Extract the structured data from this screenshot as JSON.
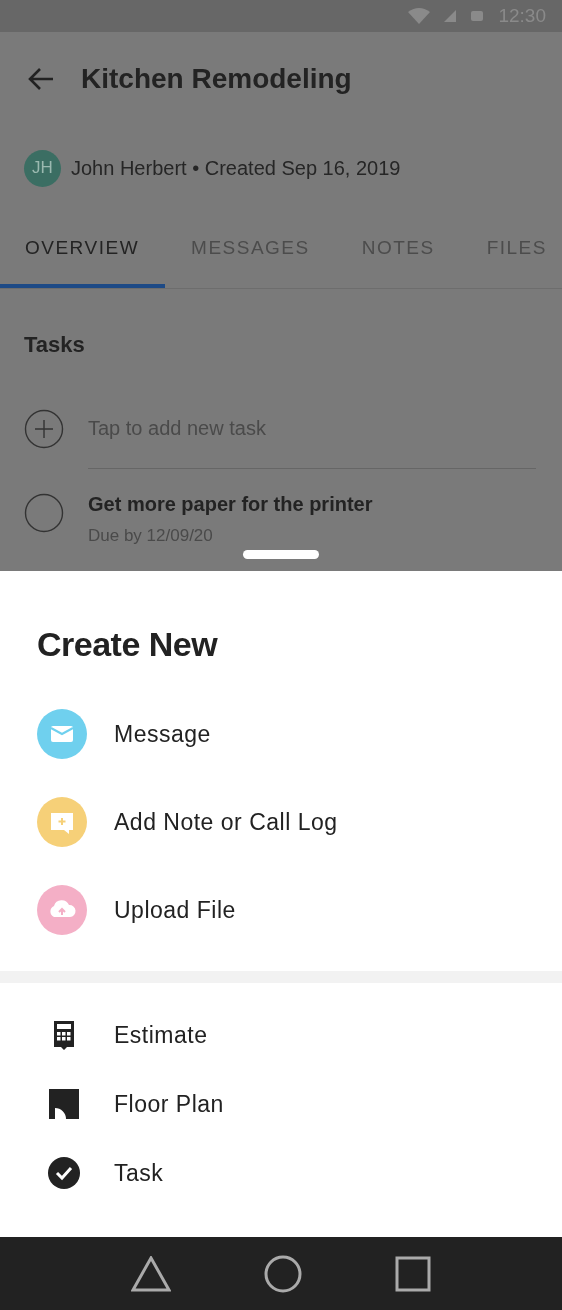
{
  "status_bar": {
    "time": "12:30"
  },
  "header": {
    "title": "Kitchen Remodeling",
    "avatar_initials": "JH",
    "meta": "John Herbert • Created Sep 16, 2019"
  },
  "tabs": [
    {
      "label": "OVERVIEW",
      "selected": true
    },
    {
      "label": "MESSAGES",
      "selected": false
    },
    {
      "label": "NOTES",
      "selected": false
    },
    {
      "label": "FILES",
      "selected": false
    }
  ],
  "tasks": {
    "heading": "Tasks",
    "add_placeholder": "Tap to add new task",
    "items": [
      {
        "title": "Get more paper for the printer",
        "due": "Due by 12/09/20",
        "checked": false
      }
    ]
  },
  "sheet": {
    "title": "Create New",
    "primary_items": [
      {
        "label": "Message",
        "kind": "envelope",
        "color": "#6fd0ee"
      },
      {
        "label": "Add Note or Call Log",
        "kind": "note",
        "color": "#f6d078"
      },
      {
        "label": "Upload File",
        "kind": "upload",
        "color": "#f4afc6"
      }
    ],
    "secondary_items": [
      {
        "label": "Estimate",
        "kind": "calculator"
      },
      {
        "label": "Floor Plan",
        "kind": "floorplan"
      },
      {
        "label": "Task",
        "kind": "check"
      }
    ]
  }
}
